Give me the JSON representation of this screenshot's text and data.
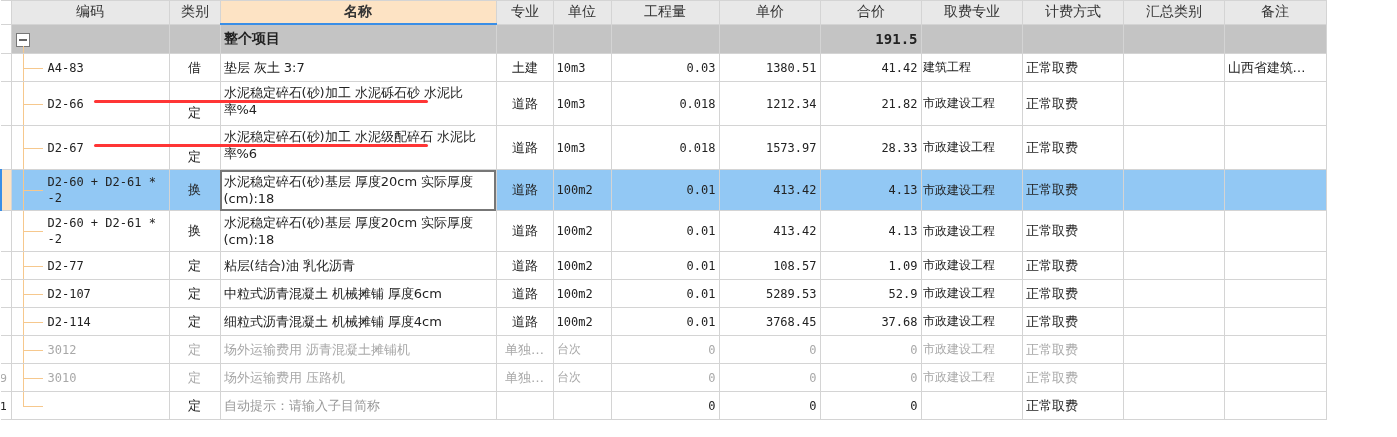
{
  "columns": [
    {
      "label": "编码",
      "selected": false
    },
    {
      "label": "类别",
      "selected": false
    },
    {
      "label": "名称",
      "selected": true
    },
    {
      "label": "专业",
      "selected": false
    },
    {
      "label": "单位",
      "selected": false
    },
    {
      "label": "工程量",
      "selected": false
    },
    {
      "label": "单价",
      "selected": false
    },
    {
      "label": "合价",
      "selected": false
    },
    {
      "label": "取费专业",
      "selected": false
    },
    {
      "label": "计费方式",
      "selected": false
    },
    {
      "label": "汇总类别",
      "selected": false
    },
    {
      "label": "备注",
      "selected": false
    }
  ],
  "group": {
    "name": "整个项目",
    "total": "191.5",
    "expanded": true
  },
  "rows": [
    {
      "code": "A4-83",
      "type": "借",
      "name": "垫层 灰土 3:7",
      "specialty": "土建",
      "unit": "10m3",
      "quantity": "0.03",
      "unit_price": "1380.51",
      "total": "41.42",
      "fee_specialty": "建筑工程",
      "fee_method": "正常取费",
      "remark": "山西省建筑…",
      "selected": false,
      "disabled": false,
      "marked": false
    },
    {
      "code": "D2-66",
      "type": "定",
      "name": "水泥稳定碎石(砂)加工 水泥砾石砂 水泥比率%4",
      "specialty": "道路",
      "unit": "10m3",
      "quantity": "0.018",
      "unit_price": "1212.34",
      "total": "21.82",
      "fee_specialty": "市政建设工程",
      "fee_method": "正常取费",
      "selected": false,
      "disabled": false,
      "marked": true
    },
    {
      "code": "D2-67",
      "type": "定",
      "name": "水泥稳定碎石(砂)加工 水泥级配碎石 水泥比率%6",
      "specialty": "道路",
      "unit": "10m3",
      "quantity": "0.018",
      "unit_price": "1573.97",
      "total": "28.33",
      "fee_specialty": "市政建设工程",
      "fee_method": "正常取费",
      "selected": false,
      "disabled": false,
      "marked": true
    },
    {
      "code": "D2-60 + D2-61 * -2",
      "type": "换",
      "name": "水泥稳定碎石(砂)基层 厚度20cm  实际厚度(cm):18",
      "specialty": "道路",
      "unit": "100m2",
      "quantity": "0.01",
      "unit_price": "413.42",
      "total": "4.13",
      "fee_specialty": "市政建设工程",
      "fee_method": "正常取费",
      "selected": true,
      "disabled": false,
      "marked": false
    },
    {
      "code": "D2-60 + D2-61 * -2",
      "type": "换",
      "name": "水泥稳定碎石(砂)基层 厚度20cm  实际厚度(cm):18",
      "specialty": "道路",
      "unit": "100m2",
      "quantity": "0.01",
      "unit_price": "413.42",
      "total": "4.13",
      "fee_specialty": "市政建设工程",
      "fee_method": "正常取费",
      "selected": false,
      "disabled": false,
      "marked": false
    },
    {
      "code": "D2-77",
      "type": "定",
      "name": "粘层(结合)油 乳化沥青",
      "specialty": "道路",
      "unit": "100m2",
      "quantity": "0.01",
      "unit_price": "108.57",
      "total": "1.09",
      "fee_specialty": "市政建设工程",
      "fee_method": "正常取费",
      "selected": false,
      "disabled": false,
      "marked": false
    },
    {
      "code": "D2-107",
      "type": "定",
      "name": "中粒式沥青混凝土 机械摊铺 厚度6cm",
      "specialty": "道路",
      "unit": "100m2",
      "quantity": "0.01",
      "unit_price": "5289.53",
      "total": "52.9",
      "fee_specialty": "市政建设工程",
      "fee_method": "正常取费",
      "selected": false,
      "disabled": false,
      "marked": false
    },
    {
      "code": "D2-114",
      "type": "定",
      "name": "细粒式沥青混凝土 机械摊铺 厚度4cm",
      "specialty": "道路",
      "unit": "100m2",
      "quantity": "0.01",
      "unit_price": "3768.45",
      "total": "37.68",
      "fee_specialty": "市政建设工程",
      "fee_method": "正常取费",
      "selected": false,
      "disabled": false,
      "marked": false
    },
    {
      "code": "3012",
      "type": "定",
      "name": "场外运输费用 沥青混凝土摊铺机",
      "specialty": "单独…",
      "unit": "台次",
      "quantity": "0",
      "unit_price": "0",
      "total": "0",
      "fee_specialty": "市政建设工程",
      "fee_method": "正常取费",
      "selected": false,
      "disabled": true,
      "marked": false
    },
    {
      "row_number": "9",
      "code": "3010",
      "type": "定",
      "name": "场外运输费用 压路机",
      "specialty": "单独…",
      "unit": "台次",
      "quantity": "0",
      "unit_price": "0",
      "total": "0",
      "fee_specialty": "市政建设工程",
      "fee_method": "正常取费",
      "selected": false,
      "disabled": true,
      "marked": false
    },
    {
      "row_number": "1",
      "type": "定",
      "placeholder": "自动提示：请输入子目简称",
      "quantity": "0",
      "unit_price": "0",
      "total": "0",
      "fee_method": "正常取费",
      "selected": false,
      "disabled": false,
      "marked": false
    }
  ]
}
